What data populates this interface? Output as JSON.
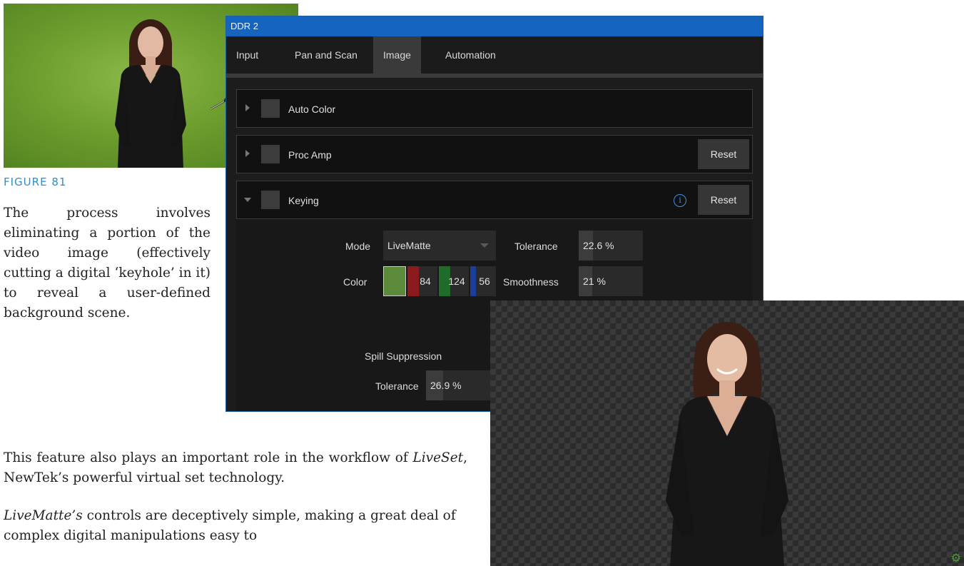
{
  "figure_caption": "FIGURE 81",
  "paragraph1": "The process involves eliminating a portion of the video image (effectively cutting a digital ‘keyhole’ in it) to reveal a user-defined background scene.",
  "paragraph2": {
    "pre": "This feature also plays an important role in the workflow of ",
    "em": "LiveSet",
    "post": ", NewTek’s powerful virtual set technology."
  },
  "paragraph3": {
    "em": "LiveMatte’s",
    "post": " controls are deceptively simple, making a great deal of complex digital manipulations easy to"
  },
  "ddr": {
    "title": "DDR 2",
    "tabs": [
      "Input",
      "Pan and Scan",
      "Image",
      "Automation"
    ],
    "active_tab": "Image",
    "sections": {
      "auto_color": "Auto Color",
      "proc_amp": "Proc Amp",
      "keying": "Keying"
    },
    "reset_label": "Reset",
    "info_glyph": "i",
    "keying": {
      "mode_label": "Mode",
      "mode_value": "LiveMatte",
      "color_label": "Color",
      "color_swatch": "#5a8a3a",
      "color_r": "84",
      "color_g": "124",
      "color_b": "56",
      "tolerance_label": "Tolerance",
      "tolerance_value": "22.6 %",
      "tolerance_level": 0.226,
      "smoothness_label": "Smoothness",
      "smoothness_value": "21 %",
      "smoothness_level": 0.21,
      "spill_label": "Spill Suppression",
      "spill_tolerance_label": "Tolerance",
      "spill_tolerance_value": "26.9 %",
      "spill_tolerance_level": 0.269
    }
  },
  "icons": {
    "eyedropper": "eyedropper-icon",
    "gear": "gear-icon"
  },
  "colors": {
    "accent_blue": "#1565c0",
    "caption_blue": "#2e8fc9",
    "green_screen": "#6e9e2e",
    "red_channel": "#8b1a1a",
    "green_channel": "#1f6b2a",
    "blue_channel": "#1a3f9b"
  }
}
